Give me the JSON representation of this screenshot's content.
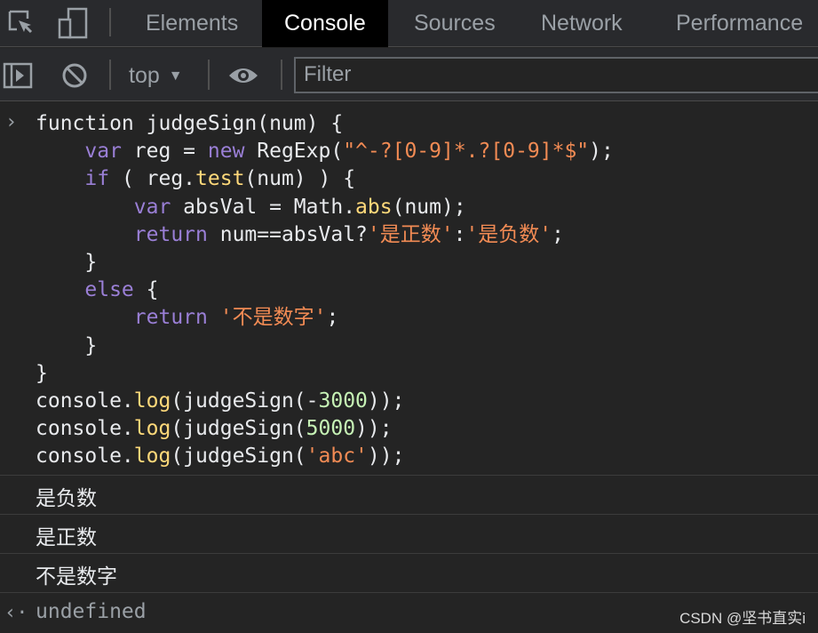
{
  "tabs": [
    {
      "label": "Elements"
    },
    {
      "label": "Console"
    },
    {
      "label": "Sources"
    },
    {
      "label": "Network"
    },
    {
      "label": "Performance"
    }
  ],
  "toolbar": {
    "context": "top",
    "filter_placeholder": "Filter"
  },
  "console": {
    "input_lines": [
      "function judgeSign(num) {",
      "    var reg = new RegExp(\"^-?[0-9]*.?[0-9]*$\");",
      "    if ( reg.test(num) ) {",
      "        var absVal = Math.abs(num);",
      "        return num==absVal?'是正数':'是负数';",
      "    }",
      "    else {",
      "        return '不是数字';",
      "    }",
      "}",
      "console.log(judgeSign(-3000));",
      "console.log(judgeSign(5000));",
      "console.log(judgeSign('abc'));"
    ],
    "outputs": [
      "是负数",
      "是正数",
      "不是数字"
    ],
    "return_value": "undefined"
  },
  "watermark": "CSDN @坚书直实i",
  "colors": {
    "keyword": "#9a7fd6",
    "string": "#f28b54",
    "number": "#c6f2b5",
    "method": "#ffd97a",
    "background": "#242424"
  }
}
